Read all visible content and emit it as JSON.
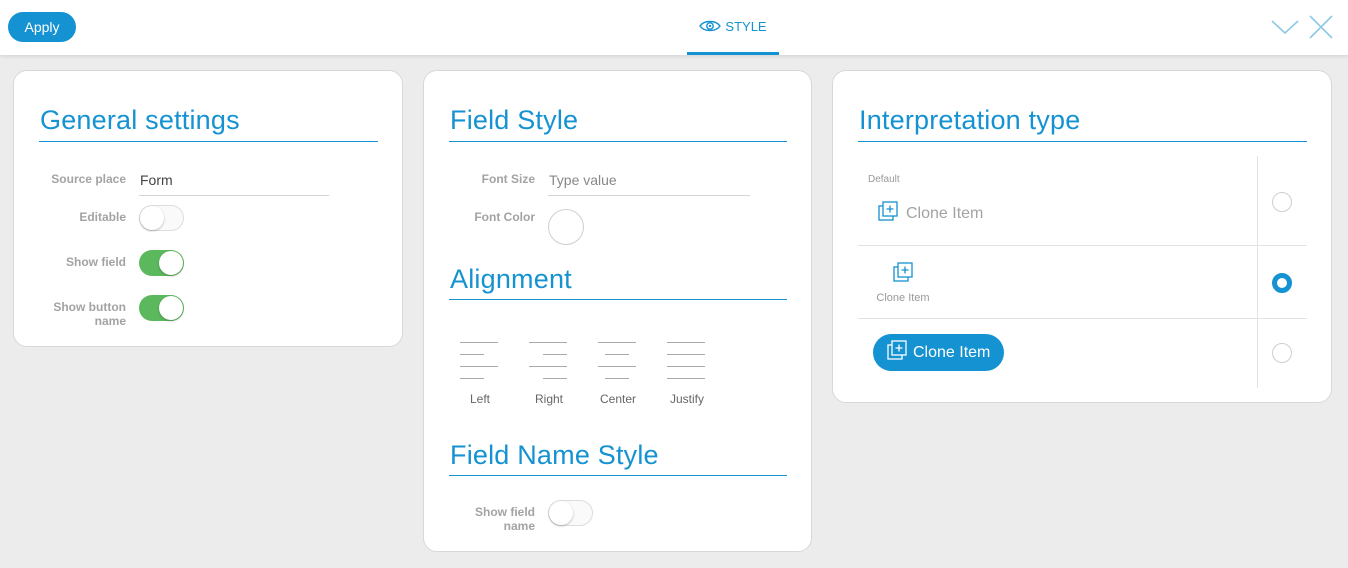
{
  "toolbar": {
    "apply_label": "Apply",
    "active_tab_label": "STYLE",
    "tab_icon": "eye-icon",
    "collapse_icon": "chevron-down-icon",
    "close_icon": "close-icon"
  },
  "general_settings": {
    "title": "General settings",
    "source_place": {
      "label": "Source place",
      "value": "Form"
    },
    "editable": {
      "label": "Editable",
      "on": false
    },
    "show_field": {
      "label": "Show field",
      "on": true
    },
    "show_button_name": {
      "label_line1": "Show button",
      "label_line2": "name",
      "on": true
    }
  },
  "field_style": {
    "title": "Field Style",
    "font_size": {
      "label": "Font Size",
      "placeholder": "Type value"
    },
    "font_color": {
      "label": "Font Color"
    }
  },
  "alignment": {
    "title": "Alignment",
    "options": [
      {
        "label": "Left",
        "icon": "align-left-icon"
      },
      {
        "label": "Right",
        "icon": "align-right-icon"
      },
      {
        "label": "Center",
        "icon": "align-center-icon"
      },
      {
        "label": "Justify",
        "icon": "align-justify-icon"
      }
    ]
  },
  "field_name_style": {
    "title": "Field Name Style",
    "show_field_name": {
      "label_line1": "Show field",
      "label_line2": "name",
      "on": false
    }
  },
  "interpretation": {
    "title": "Interpretation type",
    "options": [
      {
        "tag": "Default",
        "text": "Clone Item",
        "variant": "icon-text",
        "selected": false
      },
      {
        "text": "Clone Item",
        "variant": "icon-over-text",
        "selected": true
      },
      {
        "text": "Clone Item",
        "variant": "button",
        "selected": false
      }
    ]
  },
  "colors": {
    "accent": "#1592d1",
    "toggle_on": "#5cb85c",
    "background": "#ececed"
  }
}
